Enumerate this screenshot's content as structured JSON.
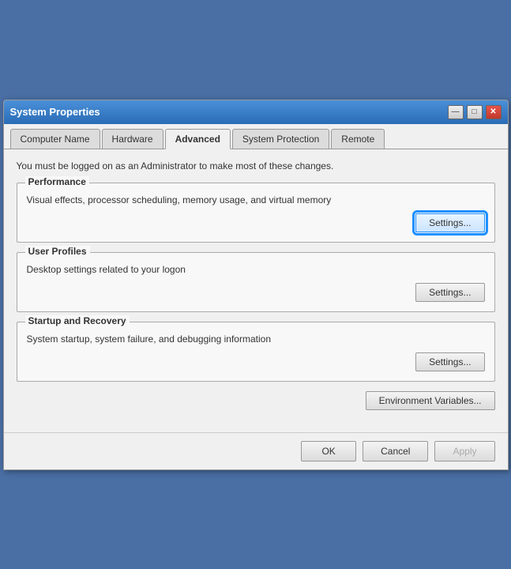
{
  "window": {
    "title": "System Properties"
  },
  "title_bar": {
    "minimize_label": "—",
    "maximize_label": "□",
    "close_label": "✕"
  },
  "tabs": [
    {
      "id": "computer-name",
      "label": "Computer Name",
      "active": false
    },
    {
      "id": "hardware",
      "label": "Hardware",
      "active": false
    },
    {
      "id": "advanced",
      "label": "Advanced",
      "active": true
    },
    {
      "id": "system-protection",
      "label": "System Protection",
      "active": false
    },
    {
      "id": "remote",
      "label": "Remote",
      "active": false
    }
  ],
  "warning": {
    "text": "You must be logged on as an Administrator to make most of these changes."
  },
  "performance": {
    "group_label": "Performance",
    "description": "Visual effects, processor scheduling, memory usage, and virtual memory",
    "settings_label": "Settings..."
  },
  "user_profiles": {
    "group_label": "User Profiles",
    "description": "Desktop settings related to your logon",
    "settings_label": "Settings..."
  },
  "startup_recovery": {
    "group_label": "Startup and Recovery",
    "description": "System startup, system failure, and debugging information",
    "settings_label": "Settings..."
  },
  "env_variables": {
    "label": "Environment Variables..."
  },
  "footer": {
    "ok_label": "OK",
    "cancel_label": "Cancel",
    "apply_label": "Apply"
  }
}
